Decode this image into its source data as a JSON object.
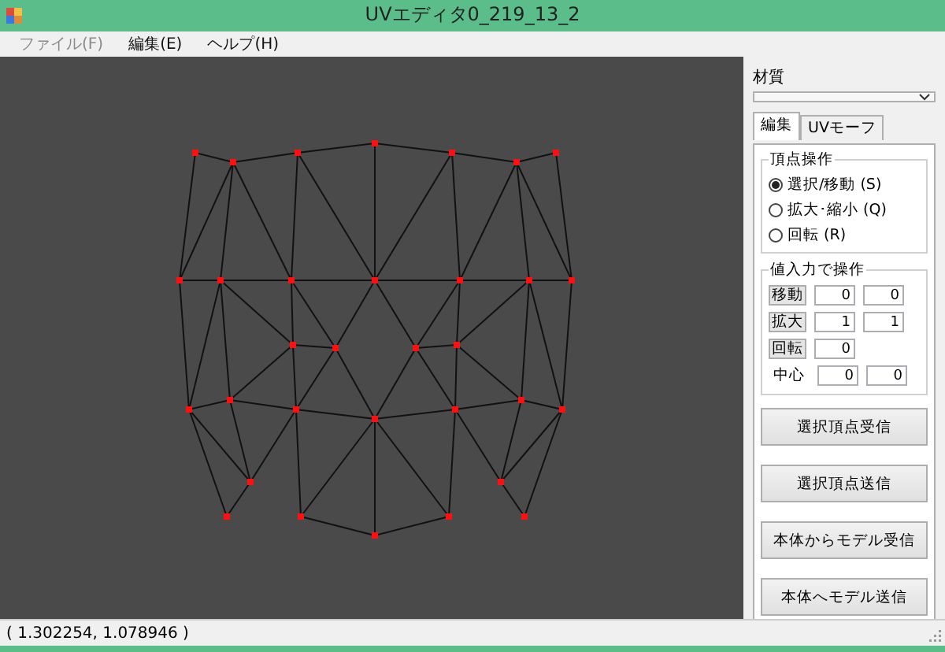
{
  "window": {
    "title": "UVエディタ0_219_13_2"
  },
  "menu": [
    {
      "label": "ファイル(F)",
      "disabled": true
    },
    {
      "label": "編集(E)",
      "disabled": false
    },
    {
      "label": "ヘルプ(H)",
      "disabled": false
    }
  ],
  "material": {
    "label": "材質"
  },
  "tabs": [
    {
      "label": "編集",
      "selected": true
    },
    {
      "label": "UVモーフ",
      "selected": false
    }
  ],
  "vertex_ops": {
    "title": "頂点操作",
    "options": [
      {
        "label": "選択/移動 (S)",
        "selected": true
      },
      {
        "label": "拡大･縮小 (Q)",
        "selected": false
      },
      {
        "label": "回転 (R)",
        "selected": false
      }
    ]
  },
  "numeric_ops": {
    "title": "値入力で操作",
    "rows": [
      {
        "kind": "button",
        "label": "移動",
        "values": [
          "0",
          "0"
        ]
      },
      {
        "kind": "button",
        "label": "拡大",
        "values": [
          "1",
          "1"
        ]
      },
      {
        "kind": "button",
        "label": "回転",
        "values": [
          "0"
        ]
      },
      {
        "kind": "label",
        "label": "中心",
        "values": [
          "0",
          "0"
        ]
      }
    ]
  },
  "actions": [
    "選択頂点受信",
    "選択頂点送信",
    "本体からモデル受信",
    "本体へモデル送信"
  ],
  "status_bar": "( 1.302254, 1.078946 )"
}
